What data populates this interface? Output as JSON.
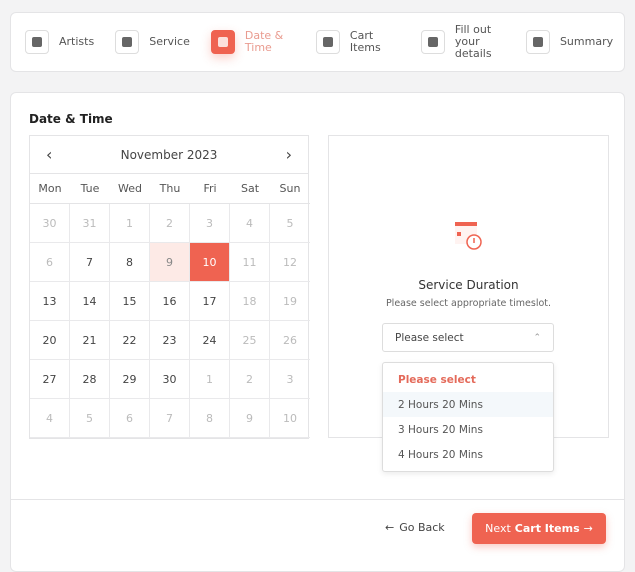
{
  "steps": [
    {
      "label": "Artists",
      "icon": "users-icon",
      "active": false
    },
    {
      "label": "Service",
      "icon": "server-icon",
      "active": false
    },
    {
      "label": "Date & Time",
      "icon": "calendar-icon",
      "active": true
    },
    {
      "label": "Cart Items",
      "icon": "cart-icon",
      "active": false
    },
    {
      "label": "Fill out your details",
      "icon": "form-icon",
      "active": false
    },
    {
      "label": "Summary",
      "icon": "clipboard-check-icon",
      "active": false
    }
  ],
  "title": "Date & Time",
  "calendar": {
    "month": "November 2023",
    "weekdays": [
      "Mon",
      "Tue",
      "Wed",
      "Thu",
      "Fri",
      "Sat",
      "Sun"
    ],
    "days": [
      {
        "d": "30",
        "s": "muted"
      },
      {
        "d": "31",
        "s": "muted"
      },
      {
        "d": "1",
        "s": "muted"
      },
      {
        "d": "2",
        "s": "muted"
      },
      {
        "d": "3",
        "s": "muted"
      },
      {
        "d": "4",
        "s": "muted"
      },
      {
        "d": "5",
        "s": "muted"
      },
      {
        "d": "6",
        "s": "muted"
      },
      {
        "d": "7",
        "s": ""
      },
      {
        "d": "8",
        "s": ""
      },
      {
        "d": "9",
        "s": "hl"
      },
      {
        "d": "10",
        "s": "sel"
      },
      {
        "d": "11",
        "s": "muted"
      },
      {
        "d": "12",
        "s": "muted"
      },
      {
        "d": "13",
        "s": ""
      },
      {
        "d": "14",
        "s": ""
      },
      {
        "d": "15",
        "s": ""
      },
      {
        "d": "16",
        "s": ""
      },
      {
        "d": "17",
        "s": ""
      },
      {
        "d": "18",
        "s": "muted"
      },
      {
        "d": "19",
        "s": "muted"
      },
      {
        "d": "20",
        "s": ""
      },
      {
        "d": "21",
        "s": ""
      },
      {
        "d": "22",
        "s": ""
      },
      {
        "d": "23",
        "s": ""
      },
      {
        "d": "24",
        "s": ""
      },
      {
        "d": "25",
        "s": "muted"
      },
      {
        "d": "26",
        "s": "muted"
      },
      {
        "d": "27",
        "s": ""
      },
      {
        "d": "28",
        "s": ""
      },
      {
        "d": "29",
        "s": ""
      },
      {
        "d": "30",
        "s": ""
      },
      {
        "d": "1",
        "s": "muted"
      },
      {
        "d": "2",
        "s": "muted"
      },
      {
        "d": "3",
        "s": "muted"
      },
      {
        "d": "4",
        "s": "muted"
      },
      {
        "d": "5",
        "s": "muted"
      },
      {
        "d": "6",
        "s": "muted"
      },
      {
        "d": "7",
        "s": "muted"
      },
      {
        "d": "8",
        "s": "muted"
      },
      {
        "d": "9",
        "s": "muted"
      },
      {
        "d": "10",
        "s": "muted"
      }
    ],
    "selected": "10"
  },
  "duration": {
    "title": "Service Duration",
    "subtitle": "Please select appropriate timeslot.",
    "select_value": "Please select",
    "options": [
      "Please select",
      "2 Hours 20 Mins",
      "3 Hours 20 Mins",
      "4 Hours 20 Mins"
    ]
  },
  "footer": {
    "back": "Go Back",
    "next_prefix": "Next",
    "next_bold": "Cart Items"
  },
  "colors": {
    "accent": "#ef6351"
  }
}
